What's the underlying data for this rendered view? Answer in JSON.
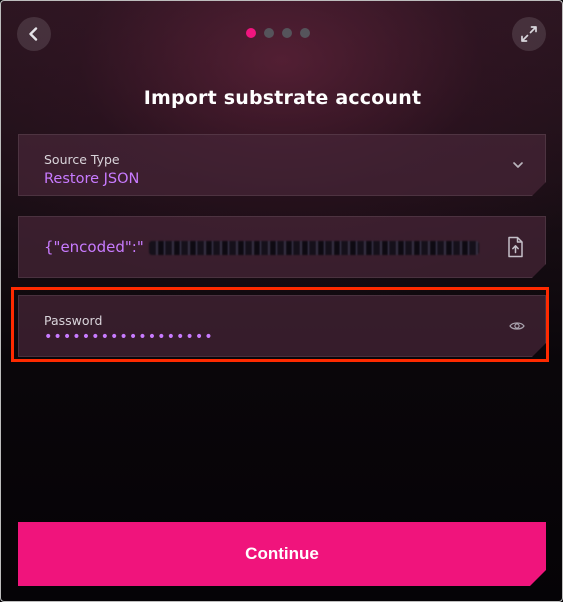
{
  "header": {
    "back_icon": "chevron-left-icon",
    "expand_icon": "expand-arrows-icon",
    "step_dots": [
      {
        "active": true
      },
      {
        "active": false
      },
      {
        "active": false
      },
      {
        "active": false
      }
    ]
  },
  "title": "Import substrate account",
  "source_type": {
    "label": "Source Type",
    "value": "Restore JSON",
    "icon": "chevron-down-icon"
  },
  "json_file": {
    "value": "{\"encoded\":\"",
    "value_redacted": true,
    "icon": "file-upload-icon"
  },
  "password": {
    "label": "Password",
    "value": "••••••••••••••••••",
    "icon": "eye-icon",
    "highlighted": true
  },
  "continue_label": "Continue",
  "colors": {
    "accent": "#f0147c",
    "value_text": "#c87bff",
    "highlight_border": "#ff2a00"
  }
}
